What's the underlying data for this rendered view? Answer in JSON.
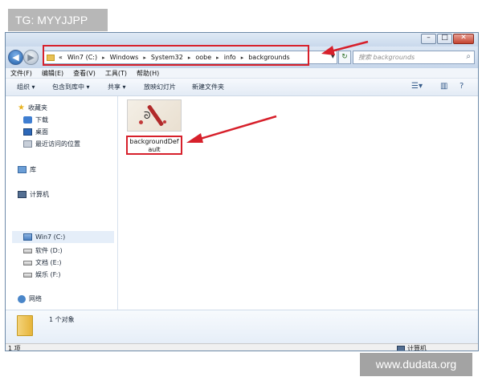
{
  "watermarks": {
    "top": "TG: MYYJJPP",
    "bottom": "www.dudata.org"
  },
  "address": {
    "prefix": "«",
    "segments": [
      "Win7 (C:)",
      "Windows",
      "System32",
      "oobe",
      "info",
      "backgrounds"
    ],
    "separator": "▸"
  },
  "search": {
    "placeholder": "搜索 backgrounds"
  },
  "menu": [
    "文件(F)",
    "编辑(E)",
    "查看(V)",
    "工具(T)",
    "帮助(H)"
  ],
  "toolbar": {
    "organize": "组织 ▾",
    "include": "包含到库中 ▾",
    "share": "共享 ▾",
    "slideshow": "放映幻灯片",
    "new_folder": "新建文件夹"
  },
  "nav": {
    "favorites": "收藏夹",
    "downloads": "下载",
    "desktop": "桌面",
    "recent": "最近访问的位置",
    "libraries": "库",
    "computer": "计算机",
    "drive_c": "Win7 (C:)",
    "drive_d": "软件 (D:)",
    "drive_e": "文档 (E:)",
    "drive_f": "娱乐 (F:)",
    "network": "网络"
  },
  "file": {
    "name": "backgroundDefault"
  },
  "details": {
    "count": "1 个对象"
  },
  "status": {
    "items": "1 项",
    "computer": "计算机"
  },
  "colors": {
    "highlight": "#d7202b",
    "selection": "#e5eef9",
    "chrome": "#c6d6ea"
  }
}
